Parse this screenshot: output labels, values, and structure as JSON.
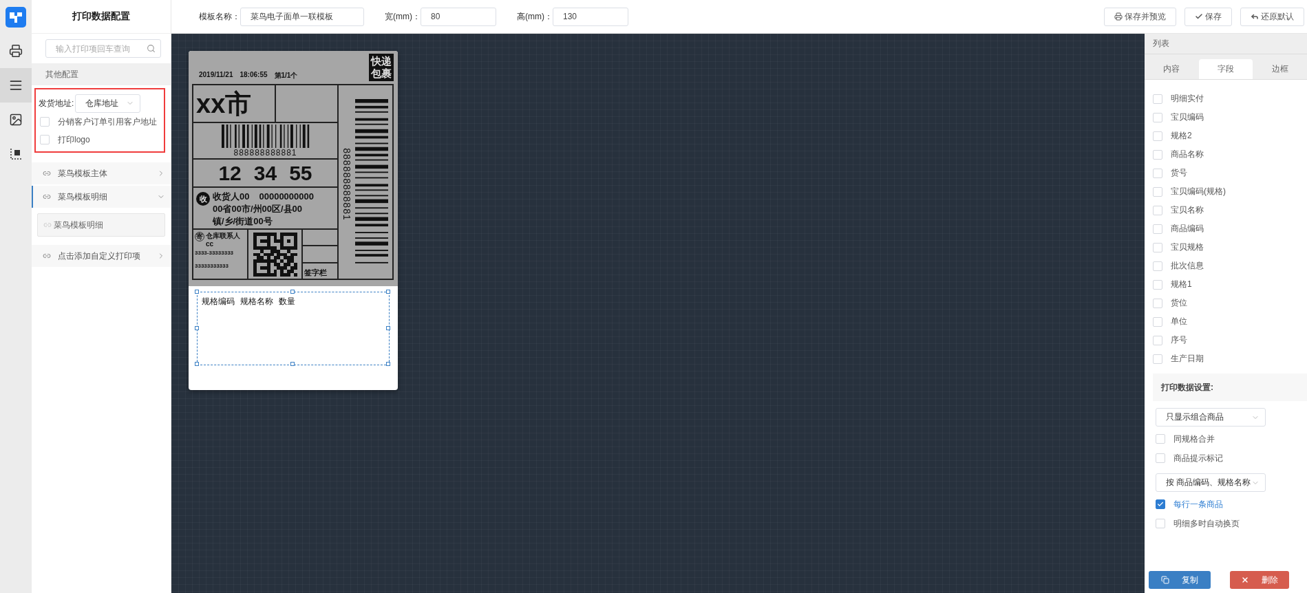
{
  "rail": [
    {
      "kind": "printer",
      "selected": false
    },
    {
      "kind": "list",
      "selected": true
    },
    {
      "kind": "image",
      "selected": false
    },
    {
      "kind": "crop",
      "selected": false
    }
  ],
  "left_panel": {
    "title": "打印数据配置",
    "search": {
      "placeholder": "输入打印项回车查询"
    },
    "band": "其他配置",
    "address": {
      "label": "发货地址:",
      "value": "仓库地址"
    },
    "options": [
      {
        "label": "分销客户订单引用客户地址",
        "checked": false
      },
      {
        "label": "打印logo",
        "checked": false
      }
    ],
    "sections": [
      {
        "label": "菜鸟模板主体",
        "expanded": false
      },
      {
        "label": "菜鸟模板明细",
        "expanded": true,
        "children": [
          {
            "label": "菜鸟模板明细"
          }
        ]
      },
      {
        "label": "点击添加自定义打印项",
        "expanded": false
      }
    ]
  },
  "toolbar": {
    "fields": [
      {
        "label": "模板名称：",
        "value": "菜鸟电子面单一联模板",
        "kind": "wide"
      },
      {
        "label": "宽(mm)：",
        "value": "80",
        "kind": "narrow"
      },
      {
        "label": "高(mm)：",
        "value": "130",
        "kind": "narrow"
      }
    ],
    "buttons": [
      {
        "kind": "print",
        "label": "保存并预览"
      },
      {
        "kind": "check",
        "label": "保存"
      },
      {
        "kind": "undo",
        "label": "还原默认"
      }
    ]
  },
  "label": {
    "date": "2019/11/21",
    "time": "18:06:55",
    "count": "第1/1个",
    "badge": [
      "快递",
      "包裹"
    ],
    "city": "xx市",
    "barcode_number": "888888888881",
    "sort_codes": [
      "12",
      "34",
      "55"
    ],
    "recipient_mark": "收",
    "recipient": "收货人00",
    "recipient_phone": "00000000000",
    "address_lines": [
      "00省00市/州00区/县00",
      "镇/乡/街道00号"
    ],
    "sender_mark": "寄",
    "sender": "仓库联系人",
    "sender_sub": "cc",
    "sender_phone": "3333-33333333",
    "sender_mobile": "33333333333",
    "signature": "签字栏",
    "side_number": "888888888881"
  },
  "detail": {
    "columns": [
      "规格编码",
      "规格名称",
      "数量"
    ]
  },
  "right_panel": {
    "title": "列表",
    "tabs": [
      {
        "label": "内容",
        "selected": false
      },
      {
        "label": "字段",
        "selected": true
      },
      {
        "label": "边框",
        "selected": false
      }
    ],
    "fields": [
      {
        "label": "明细实付",
        "checked": false
      },
      {
        "label": "宝贝编码",
        "checked": false
      },
      {
        "label": "规格2",
        "checked": false
      },
      {
        "label": "商品名称",
        "checked": false
      },
      {
        "label": "货号",
        "checked": false
      },
      {
        "label": "宝贝编码(规格)",
        "checked": false
      },
      {
        "label": "宝贝名称",
        "checked": false
      },
      {
        "label": "商品编码",
        "checked": false
      },
      {
        "label": "宝贝规格",
        "checked": false
      },
      {
        "label": "批次信息",
        "checked": false
      },
      {
        "label": "规格1",
        "checked": false
      },
      {
        "label": "货位",
        "checked": false
      },
      {
        "label": "单位",
        "checked": false
      },
      {
        "label": "序号",
        "checked": false
      },
      {
        "label": "生产日期",
        "checked": false
      }
    ],
    "settings_title": "打印数据设置:",
    "settings": [
      {
        "kind": "select",
        "value": "只显示组合商品"
      },
      {
        "kind": "checkbox",
        "label": "同规格合并",
        "checked": false
      },
      {
        "kind": "checkbox",
        "label": "商品提示标记",
        "checked": false
      },
      {
        "kind": "select",
        "value": "按 商品编码、规格名称"
      },
      {
        "kind": "checkbox",
        "label": "每行一条商品",
        "checked": true
      },
      {
        "kind": "checkbox",
        "label": "明细多时自动换页",
        "checked": false
      }
    ],
    "actions": [
      {
        "kind": "copy",
        "label": "复制"
      },
      {
        "kind": "delete",
        "label": "删除"
      }
    ]
  }
}
